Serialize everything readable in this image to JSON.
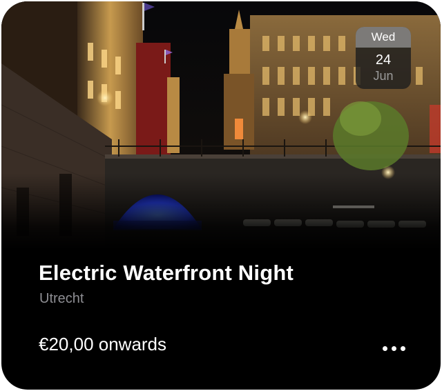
{
  "event": {
    "title": "Electric Waterfront Night",
    "city": "Utrecht",
    "price": "€20,00 onwards"
  },
  "date_badge": {
    "weekday": "Wed",
    "day": "24",
    "month": "Jun"
  },
  "icons": {
    "more": "more-horizontal-icon"
  },
  "colors": {
    "card_background": "#000000",
    "secondary_text": "#8e8e93",
    "primary_text": "#ffffff",
    "tunnel_glow": "#2a46ff",
    "lamp_glow": "#f6c86a"
  }
}
